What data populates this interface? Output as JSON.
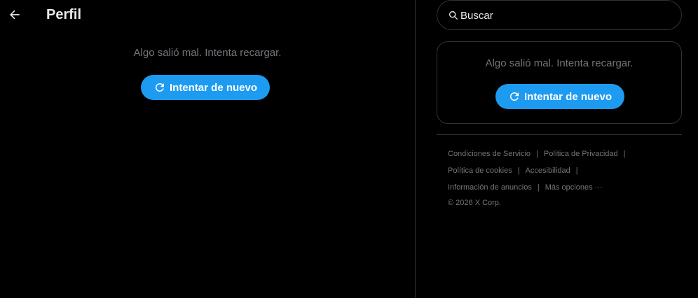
{
  "header": {
    "title": "Perfil",
    "back_icon": "arrow-left-icon"
  },
  "main": {
    "error_text": "Algo salió mal. Intenta recargar.",
    "retry_label": "Intentar de nuevo",
    "retry_icon": "refresh-icon"
  },
  "search": {
    "placeholder": "Buscar",
    "value": "",
    "icon": "search-icon"
  },
  "sidebar_card": {
    "error_text": "Algo salió mal. Intenta recargar.",
    "retry_label": "Intentar de nuevo"
  },
  "footer": {
    "links": [
      "Condiciones de Servicio",
      "Política de Privacidad",
      "Política de cookies",
      "Accesibilidad",
      "Información de anuncios",
      "Más opciones ···"
    ],
    "separator": "|",
    "copyright": "© 2026 X Corp."
  },
  "colors": {
    "background": "#000000",
    "accent": "#1d9bf0",
    "text_primary": "#e7e9ea",
    "text_secondary": "#71767b",
    "border": "#2f3336"
  }
}
